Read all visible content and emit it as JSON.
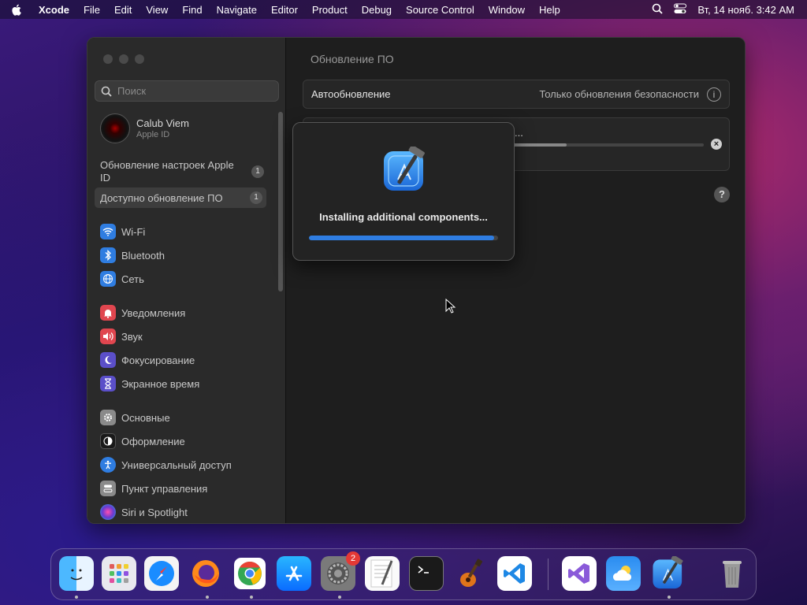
{
  "menubar": {
    "app": "Xcode",
    "items": [
      "File",
      "Edit",
      "View",
      "Find",
      "Navigate",
      "Editor",
      "Product",
      "Debug",
      "Source Control",
      "Window",
      "Help"
    ],
    "datetime": "Вт, 14 нояб.  3:42 AM"
  },
  "sidebar": {
    "search_placeholder": "Поиск",
    "account": {
      "name": "Calub Viem",
      "sub": "Apple ID"
    },
    "notices": [
      {
        "label": "Обновление настроек Apple ID",
        "badge": "1"
      },
      {
        "label": "Доступно обновление ПО",
        "badge": "1"
      }
    ],
    "items": [
      {
        "label": "Wi-Fi",
        "icon": "wifi-icon",
        "color": "#2f7de1"
      },
      {
        "label": "Bluetooth",
        "icon": "bluetooth-icon",
        "color": "#2f7de1"
      },
      {
        "label": "Сеть",
        "icon": "network-icon",
        "color": "#2f7de1"
      },
      {
        "label": "Уведомления",
        "icon": "notifications-icon",
        "color": "#e0464f"
      },
      {
        "label": "Звук",
        "icon": "sound-icon",
        "color": "#e0464f"
      },
      {
        "label": "Фокусирование",
        "icon": "focus-icon",
        "color": "#5b4fc9"
      },
      {
        "label": "Экранное время",
        "icon": "screen-time-icon",
        "color": "#5b4fc9"
      },
      {
        "label": "Основные",
        "icon": "general-icon",
        "color": "#8a8a8a"
      },
      {
        "label": "Оформление",
        "icon": "appearance-icon",
        "color": "#1a1a1a"
      },
      {
        "label": "Универсальный доступ",
        "icon": "accessibility-icon",
        "color": "#2f7de1"
      },
      {
        "label": "Пункт управления",
        "icon": "control-center-icon",
        "color": "#8a8a8a"
      },
      {
        "label": "Siri и Spotlight",
        "icon": "siri-icon",
        "color": "#6a3ad0"
      }
    ]
  },
  "main": {
    "title": "Обновление ПО",
    "auto_update_label": "Автообновление",
    "auto_update_value": "Только обновления безопасности",
    "download_text_fragment": "...",
    "download_progress": 0.3,
    "help": "?"
  },
  "dialog": {
    "message": "Installing additional components...",
    "progress": 0.98
  },
  "dock": {
    "items": [
      {
        "name": "finder-icon",
        "running": true
      },
      {
        "name": "launchpad-icon",
        "running": false
      },
      {
        "name": "safari-icon",
        "running": false
      },
      {
        "name": "firefox-icon",
        "running": true
      },
      {
        "name": "chrome-icon",
        "running": true
      },
      {
        "name": "app-store-icon",
        "running": false
      },
      {
        "name": "system-settings-icon",
        "running": true,
        "badge": "2"
      },
      {
        "name": "textedit-icon",
        "running": false
      },
      {
        "name": "terminal-icon",
        "running": false
      },
      {
        "name": "garageband-icon",
        "running": false
      },
      {
        "name": "vscode-icon",
        "running": false
      },
      {
        "name": "visual-studio-icon",
        "running": false
      },
      {
        "name": "weather-icon",
        "running": false
      },
      {
        "name": "xcode-icon",
        "running": true
      },
      {
        "name": "trash-icon",
        "running": false
      }
    ]
  }
}
